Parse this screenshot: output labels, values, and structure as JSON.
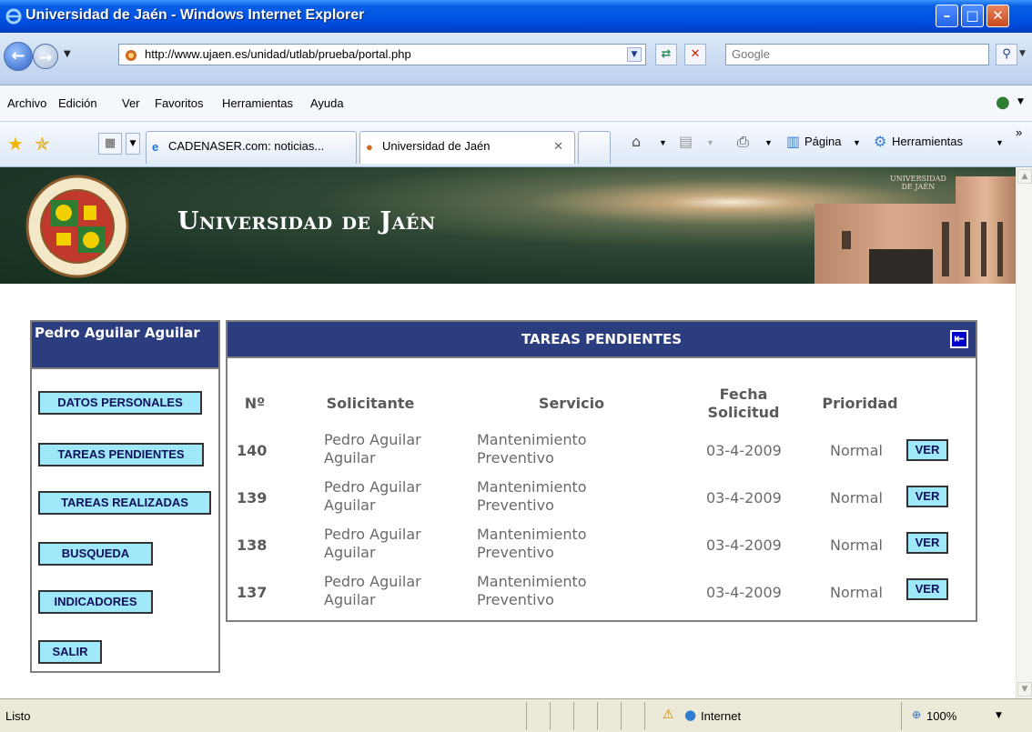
{
  "window": {
    "title": "Universidad de Jaén - Windows Internet Explorer",
    "minimize_glyph": "–",
    "maximize_glyph": "□",
    "close_glyph": "✕"
  },
  "address_bar": {
    "url": "http://www.ujaen.es/unidad/utlab/prueba/portal.php",
    "search_placeholder": "Google"
  },
  "menu": {
    "items": [
      {
        "label": "Archivo"
      },
      {
        "label": "Edición"
      },
      {
        "label": "Ver"
      },
      {
        "label": "Favoritos"
      },
      {
        "label": "Herramientas"
      },
      {
        "label": "Ayuda"
      }
    ]
  },
  "tabs": [
    {
      "label": "CADENASER.com: noticias..."
    },
    {
      "label": "Universidad de Jaén"
    }
  ],
  "commands": {
    "page_label": "Página",
    "tools_label": "Herramientas",
    "more_glyph": "»"
  },
  "banner": {
    "university_name": "Universidad de Jaén",
    "building_sign": "UNIVERSIDAD\nDE JAÉN"
  },
  "sidebar": {
    "user_name": "Pedro Aguilar Aguilar",
    "buttons": [
      {
        "label": "DATOS PERSONALES"
      },
      {
        "label": "TAREAS PENDIENTES"
      },
      {
        "label": "TAREAS REALIZADAS"
      },
      {
        "label": "BUSQUEDA"
      },
      {
        "label": "INDICADORES"
      },
      {
        "label": "SALIR"
      }
    ]
  },
  "tasks_panel": {
    "title": "TAREAS PENDIENTES",
    "columns": [
      "Nº",
      "Solicitante",
      "Servicio",
      "Fecha Solicitud",
      "Prioridad"
    ],
    "view_label": "VER",
    "rows": [
      {
        "num": "140",
        "solicitante": "Pedro Aguilar Aguilar",
        "servicio": "Mantenimiento Preventivo",
        "fecha": "03-4-2009",
        "prioridad": "Normal"
      },
      {
        "num": "139",
        "solicitante": "Pedro Aguilar Aguilar",
        "servicio": "Mantenimiento Preventivo",
        "fecha": "03-4-2009",
        "prioridad": "Normal"
      },
      {
        "num": "138",
        "solicitante": "Pedro Aguilar Aguilar",
        "servicio": "Mantenimiento Preventivo",
        "fecha": "03-4-2009",
        "prioridad": "Normal"
      },
      {
        "num": "137",
        "solicitante": "Pedro Aguilar Aguilar",
        "servicio": "Mantenimiento Preventivo",
        "fecha": "03-4-2009",
        "prioridad": "Normal"
      }
    ]
  },
  "status_bar": {
    "status": "Listo",
    "zone": "Internet",
    "zoom": "100%"
  }
}
